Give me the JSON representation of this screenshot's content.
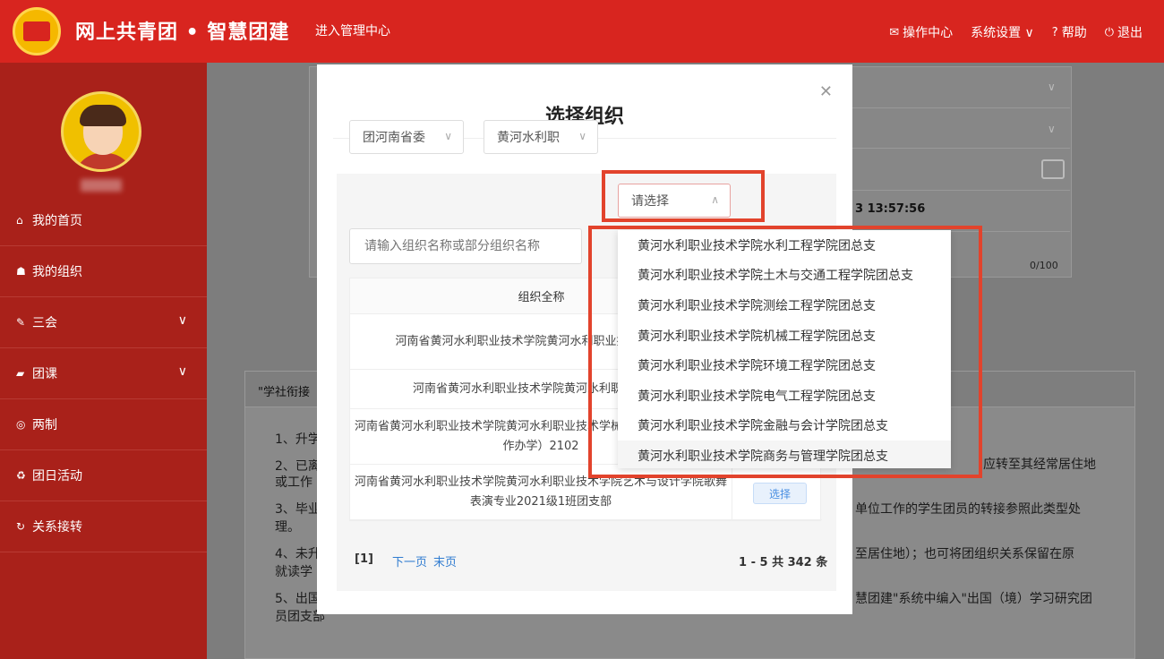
{
  "header": {
    "app_title": "网上共青团 • 智慧团建",
    "admin_link": "进入管理中心",
    "nav": [
      {
        "icon": "mail-icon",
        "glyph": "✉",
        "label": "操作中心"
      },
      {
        "icon": "chevron-down-icon",
        "glyph": "",
        "label": "系统设置 ∨"
      },
      {
        "icon": "help-icon",
        "glyph": "?",
        "label": "帮助"
      },
      {
        "icon": "power-icon",
        "glyph": "⏻",
        "label": "退出"
      }
    ]
  },
  "sidebar": {
    "items": [
      {
        "icon": "home-icon",
        "glyph": "⌂",
        "label": "我的首页",
        "chevron": ""
      },
      {
        "icon": "group-icon",
        "glyph": "☗",
        "label": "我的组织",
        "chevron": ""
      },
      {
        "icon": "edit-icon",
        "glyph": "✎",
        "label": "三会",
        "chevron": "∨"
      },
      {
        "icon": "folder-icon",
        "glyph": "▰",
        "label": "团课",
        "chevron": "∨"
      },
      {
        "icon": "circle-icon",
        "glyph": "◎",
        "label": "两制",
        "chevron": ""
      },
      {
        "icon": "recycle-icon",
        "glyph": "♻",
        "label": "团日活动",
        "chevron": ""
      },
      {
        "icon": "refresh-icon",
        "glyph": "↻",
        "label": "关系接转",
        "chevron": ""
      }
    ]
  },
  "background": {
    "timestamp": "3 13:57:56",
    "char_count": "0/100",
    "notice_title": "\"学社衔接",
    "lines": [
      {
        "text": "1、升学"
      },
      {
        "text": "2、已离"
      },
      {
        "text": "或工作"
      },
      {
        "text": "3、毕业"
      },
      {
        "text": "理。"
      },
      {
        "text": "4、未升"
      },
      {
        "text": "就读学"
      },
      {
        "text": "5、出国"
      },
      {
        "text": "员团支部"
      },
      {
        "text": "应转至其经常居住地"
      },
      {
        "text": "单位工作的学生团员的转接参照此类型处"
      },
      {
        "text": "至居住地）；也可将团组织关系保留在原"
      },
      {
        "text": "慧团建\"系统中编入\"出国（境）学习研究团"
      }
    ]
  },
  "modal": {
    "title": "选择组织",
    "selects": [
      {
        "value": "团河南省委"
      },
      {
        "value": "黄河水利职"
      },
      {
        "value": "请选择"
      }
    ],
    "search_placeholder": "请输入组织名称或部分组织名称",
    "table": {
      "header": "组织全称",
      "rows": [
        {
          "text": "河南省黄河水利职业技术学院黄河水利职业技术学团总支",
          "button": ""
        },
        {
          "text": "河南省黄河水利职业技术学院黄河水利职业技术学",
          "button": ""
        },
        {
          "text": "河南省黄河水利职业技术学院黄河水利职业技术学械设计与制造（中外合作办学）2102",
          "button": ""
        },
        {
          "text": "河南省黄河水利职业技术学院黄河水利职业技术学院艺术与设计学院歌舞表演专业2021级1班团支部",
          "button": "选择"
        }
      ]
    },
    "pager": {
      "current": "[1]",
      "next": "下一页",
      "last": "末页",
      "total": "1 - 5  共 342 条"
    }
  },
  "dropdown": {
    "options": [
      "黄河水利职业技术学院水利工程学院团总支",
      "黄河水利职业技术学院土木与交通工程学院团总支",
      "黄河水利职业技术学院测绘工程学院团总支",
      "黄河水利职业技术学院机械工程学院团总支",
      "黄河水利职业技术学院环境工程学院团总支",
      "黄河水利职业技术学院电气工程学院团总支",
      "黄河水利职业技术学院金融与会计学院团总支",
      "黄河水利职业技术学院商务与管理学院团总支"
    ]
  },
  "colors": {
    "header_red": "#d8251f",
    "sidebar_red": "#a9211a",
    "annotation_red": "#e2432c",
    "link_blue": "#2f7bd0"
  }
}
